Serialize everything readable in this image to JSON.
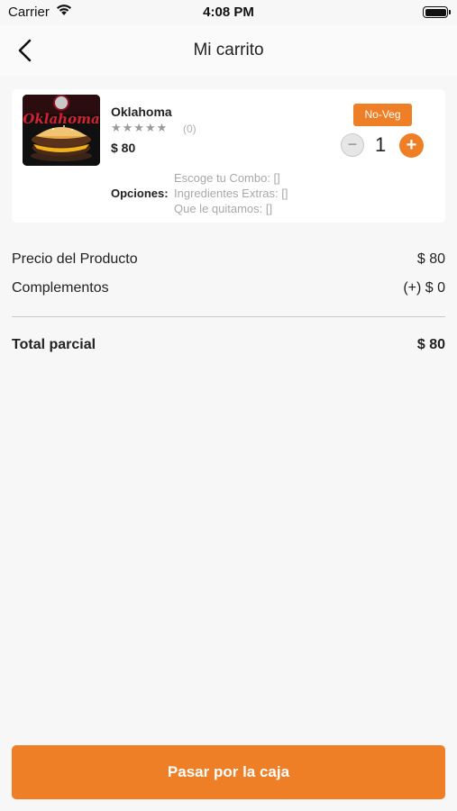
{
  "status_bar": {
    "carrier": "Carrier",
    "time": "4:08 PM"
  },
  "nav": {
    "title": "Mi carrito",
    "back_icon": "chevron-left-icon"
  },
  "cart_item": {
    "image_text": "Oklahoma",
    "name": "Oklahoma",
    "stars": "★★★★★",
    "rating_count": "(0)",
    "rating_value": 0,
    "price": "$ 80",
    "badge": "No-Veg",
    "quantity": "1",
    "minus_label": "−",
    "plus_label": "+",
    "options_label": "Opciones:",
    "options": [
      "Escoge tu Combo: []",
      "Ingredientes Extras: []",
      "Que le quitamos: []"
    ]
  },
  "summary": {
    "product_price_label": "Precio del Producto",
    "product_price_value": "$ 80",
    "complements_label": "Complementos",
    "complements_value": "(+) $ 0",
    "subtotal_label": "Total parcial",
    "subtotal_value": "$ 80"
  },
  "checkout": {
    "label": "Pasar por la caja"
  },
  "colors": {
    "accent": "#ef7f26",
    "background": "#f7f7f7",
    "card": "#ffffff"
  }
}
